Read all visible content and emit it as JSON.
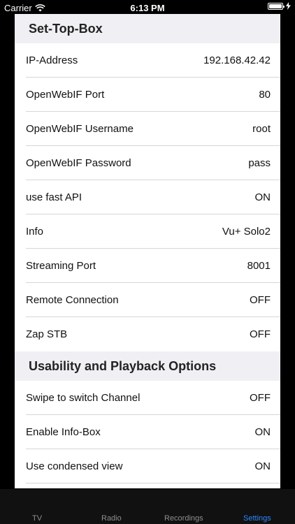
{
  "status": {
    "carrier": "Carrier",
    "time": "6:13 PM"
  },
  "sections": {
    "stb": {
      "title": "Set-Top-Box",
      "rows": [
        {
          "label": "IP-Address",
          "value": "192.168.42.42"
        },
        {
          "label": "OpenWebIF Port",
          "value": "80"
        },
        {
          "label": "OpenWebIF Username",
          "value": "root"
        },
        {
          "label": "OpenWebIF Password",
          "value": "pass"
        },
        {
          "label": "use fast API",
          "value": "ON"
        },
        {
          "label": "Info",
          "value": "Vu+ Solo2"
        },
        {
          "label": "Streaming Port",
          "value": "8001"
        },
        {
          "label": "Remote Connection",
          "value": "OFF"
        },
        {
          "label": "Zap STB",
          "value": "OFF"
        }
      ]
    },
    "usability": {
      "title": "Usability and Playback Options",
      "rows": [
        {
          "label": "Swipe to switch Channel",
          "value": "OFF"
        },
        {
          "label": "Enable Info-Box",
          "value": "ON"
        },
        {
          "label": "Use condensed view",
          "value": "ON"
        }
      ]
    }
  },
  "tabbar": {
    "items": [
      {
        "label": "TV"
      },
      {
        "label": "Radio"
      },
      {
        "label": "Recordings"
      },
      {
        "label": "Settings"
      }
    ],
    "active": "Settings",
    "active_color": "#2b88ff"
  }
}
